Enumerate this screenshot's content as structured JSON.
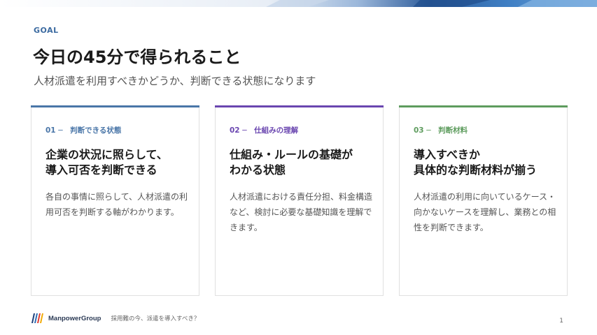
{
  "header": {
    "eyebrow": "GOAL",
    "title": "今日の45分で得られること",
    "subtitle": "人材派遣を利用すべきかどうか、判断できる状態になります"
  },
  "cards": [
    {
      "number_label": "01 ─　判断できる状態",
      "heading": "企業の状況に照らして、\n導入可否を判断できる",
      "body": "各自の事情に照らして、人材派遣の利用可否を判断する軸がわかります。",
      "accent_color": "#4a76a8"
    },
    {
      "number_label": "02 ─　仕組みの理解",
      "heading": "仕組み・ルールの基礎が\nわかる状態",
      "body": "人材派遣における責任分担、料金構造など、検討に必要な基礎知識を理解できます。",
      "accent_color": "#6a46b0"
    },
    {
      "number_label": "03 ─　判断材料",
      "heading": "導入すべきか\n具体的な判断材料が揃う",
      "body": "人材派遣の利用に向いているケース・向かないケースを理解し、業務との相性を判断できます。",
      "accent_color": "#5e9c5e"
    }
  ],
  "footer": {
    "logo_text": "ManpowerGroup",
    "caption": "採用難の今、派遣を導入すべき？",
    "page_number": "1"
  },
  "icons": {
    "logo": "manpowergroup-logo-icon"
  }
}
